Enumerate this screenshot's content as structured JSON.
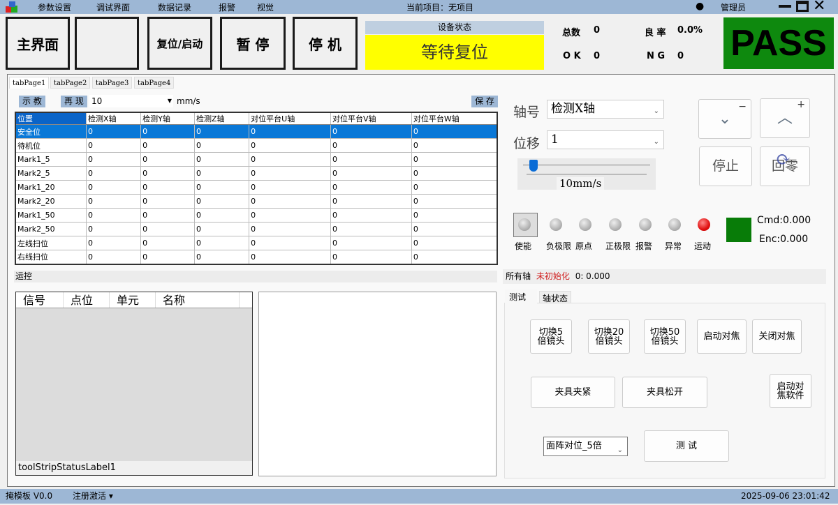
{
  "menu": {
    "items": [
      "参数设置",
      "调试界面",
      "数据记录",
      "报警",
      "视觉"
    ],
    "project": "当前项目：无项目",
    "user": "管理员"
  },
  "top_buttons": {
    "main": "主界面",
    "blank": "",
    "reset": "复位/启动",
    "pause": "暂 停",
    "stop": "停 机"
  },
  "device_status": {
    "title": "设备状态",
    "value": "等待复位"
  },
  "stats": {
    "total_label": "总数",
    "total": "0",
    "rate_label": "良 率",
    "rate": "0.0%",
    "ok_label": "O K",
    "ok": "0",
    "ng_label": "N G",
    "ng": "0"
  },
  "result": {
    "text": "PASS",
    "color": "#0e890e"
  },
  "tabs": [
    "tabPage1",
    "tabPage2",
    "tabPage3",
    "tabPage4"
  ],
  "toolbar": {
    "teach": "示 教",
    "replay": "再 现",
    "speed": "10",
    "unit": "mm/s",
    "save": "保 存"
  },
  "grid": {
    "headers": [
      "位置",
      "检测X轴",
      "检测Y轴",
      "检测Z轴",
      "对位平台U轴",
      "对位平台V轴",
      "对位平台W轴"
    ],
    "rows": [
      [
        "安全位",
        "0",
        "0",
        "0",
        "0",
        "0",
        "0"
      ],
      [
        "待机位",
        "0",
        "0",
        "0",
        "0",
        "0",
        "0"
      ],
      [
        "Mark1_5",
        "0",
        "0",
        "0",
        "0",
        "0",
        "0"
      ],
      [
        "Mark2_5",
        "0",
        "0",
        "0",
        "0",
        "0",
        "0"
      ],
      [
        "Mark1_20",
        "0",
        "0",
        "0",
        "0",
        "0",
        "0"
      ],
      [
        "Mark2_20",
        "0",
        "0",
        "0",
        "0",
        "0",
        "0"
      ],
      [
        "Mark1_50",
        "0",
        "0",
        "0",
        "0",
        "0",
        "0"
      ],
      [
        "Mark2_50",
        "0",
        "0",
        "0",
        "0",
        "0",
        "0"
      ],
      [
        "左线扫位",
        "0",
        "0",
        "0",
        "0",
        "0",
        "0"
      ],
      [
        "右线扫位",
        "0",
        "0",
        "0",
        "0",
        "0",
        "0"
      ]
    ]
  },
  "motion_label": "运控",
  "signal_list": {
    "headers": [
      "信号",
      "点位",
      "单元",
      "名称"
    ],
    "status": "toolStripStatusLabel1"
  },
  "axis": {
    "axis_label": "轴号",
    "axis_value": "检测X轴",
    "disp_label": "位移",
    "disp_value": "1",
    "speed_text": "10mm/s",
    "speed_fraction": 0.05,
    "minus": "−",
    "plus": "+",
    "stop": "停止",
    "home": "回零"
  },
  "leds": [
    {
      "label": "使能",
      "on": false
    },
    {
      "label": "负极限",
      "on": false
    },
    {
      "label": "原点",
      "on": false
    },
    {
      "label": "正极限",
      "on": false
    },
    {
      "label": "报警",
      "on": false
    },
    {
      "label": "异常",
      "on": false
    },
    {
      "label": "运动",
      "on": true
    }
  ],
  "position": {
    "cmd": "Cmd:0.000",
    "enc": "Enc:0.000",
    "indicator_color": "#087c08"
  },
  "axis_status": {
    "label": "所有轴",
    "state": "未初始化",
    "value": "0:  0.000"
  },
  "sub_tabs": [
    "测试",
    "轴状态"
  ],
  "test_buttons": {
    "lens5": "切换5倍镜头",
    "lens20": "切换20倍镜头",
    "lens50": "切换50倍镜头",
    "focus_on": "启动对焦",
    "focus_off": "关闭对焦",
    "clamp": "夹具夹紧",
    "release": "夹具松开",
    "focus_sw": "启动对焦软件",
    "mode": "面阵对位_5倍",
    "test": "测 试"
  },
  "footer": {
    "app": "掩模板 V0.0",
    "register": "注册激活 ▾",
    "datetime": "2025-09-06 23:01:42"
  }
}
